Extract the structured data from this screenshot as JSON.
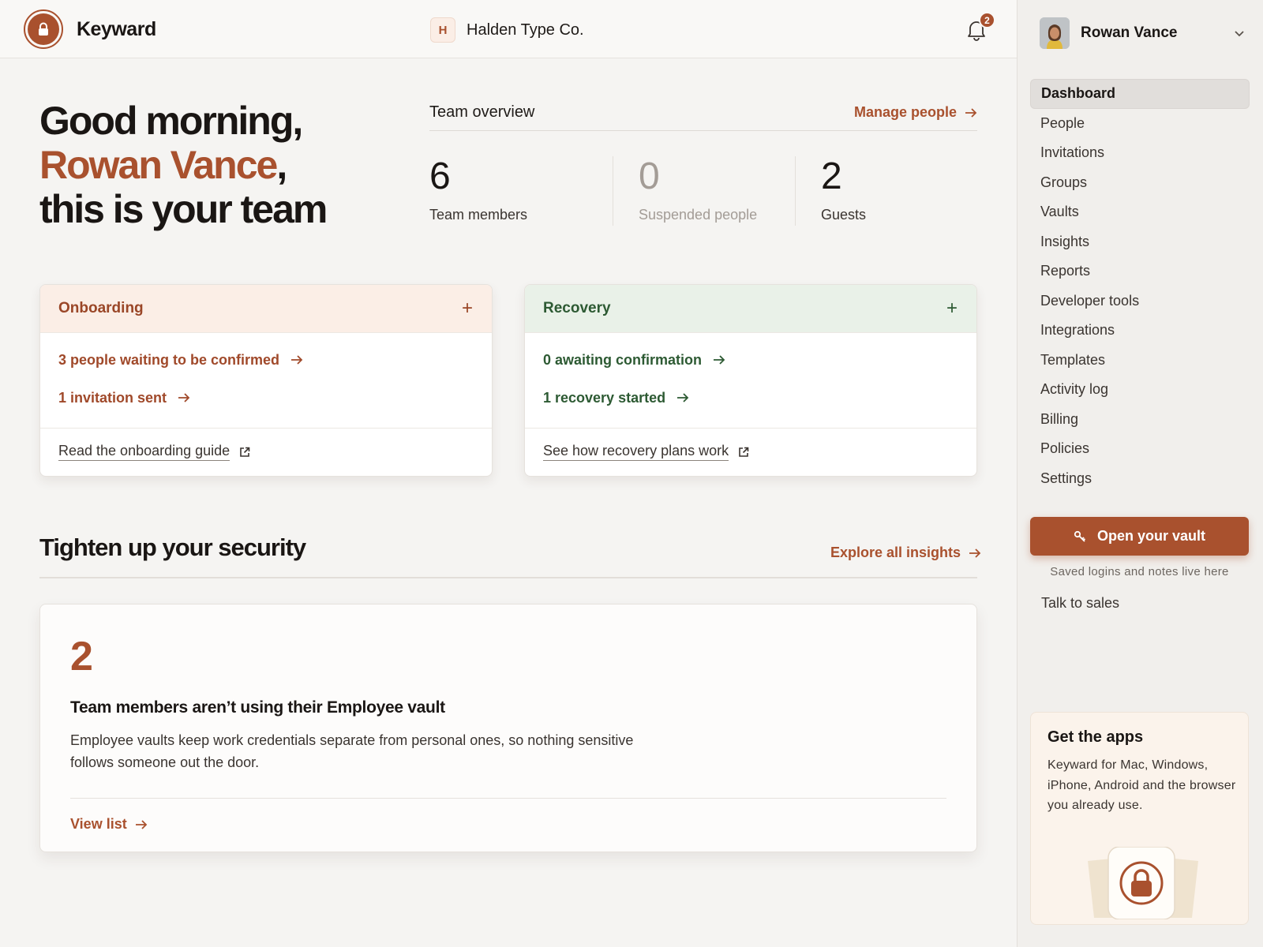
{
  "header": {
    "brand": "Keyward",
    "org_initial": "H",
    "org_name": "Halden Type Co.",
    "notification_count": "2"
  },
  "greeting": {
    "line1": "Good morning,",
    "name": "Rowan Vance",
    "name_suffix": ",",
    "line3": "this is your team"
  },
  "overview": {
    "title": "Team overview",
    "manage_link": "Manage people",
    "stats": [
      {
        "value": "6",
        "label": "Team members"
      },
      {
        "value": "0",
        "label": "Suspended people"
      },
      {
        "value": "2",
        "label": "Guests"
      }
    ]
  },
  "onboarding": {
    "title": "Onboarding",
    "add_symbol": "+",
    "rows": [
      "3 people waiting to be confirmed",
      "1 invitation sent"
    ],
    "guide": "Read the onboarding guide"
  },
  "recovery": {
    "title": "Recovery",
    "add_symbol": "+",
    "rows": [
      "0 awaiting confirmation",
      "1 recovery started"
    ],
    "guide": "See how recovery plans work"
  },
  "security": {
    "title": "Tighten up your security",
    "explore_link": "Explore all insights",
    "insight": {
      "count": "2",
      "title": "Team members aren’t using their Employee vault",
      "description": "Employee vaults keep work credentials separate from personal ones, so nothing sensitive follows someone out the door.",
      "link": "View list"
    }
  },
  "sidebar": {
    "user_name": "Rowan Vance",
    "nav": [
      "Dashboard",
      "People",
      "Invitations",
      "Groups",
      "Vaults",
      "Insights",
      "Reports",
      "Developer tools",
      "Integrations",
      "Templates",
      "Activity log",
      "Billing",
      "Policies",
      "Settings"
    ],
    "active": "Dashboard",
    "vault_button": "Open your vault",
    "vault_caption": "Saved logins and notes live here",
    "sales_link": "Talk to sales",
    "apps": {
      "title": "Get the apps",
      "description": "Keyward for Mac, Windows, iPhone, Android and the browser you already use."
    }
  },
  "icons": {
    "logo": "lock-icon",
    "bell": "bell-icon",
    "arrow": "arrow-right-icon",
    "external": "external-link-icon",
    "key": "key-icon",
    "chevron": "chevron-down-icon"
  },
  "colors": {
    "accent": "#a9512e",
    "onboarding_bg": "#fbeee6",
    "recovery_bg": "#e9f1e8",
    "recovery_text": "#2d5a33",
    "background": "#f5f4f2",
    "sidebar": "#f1efec"
  }
}
